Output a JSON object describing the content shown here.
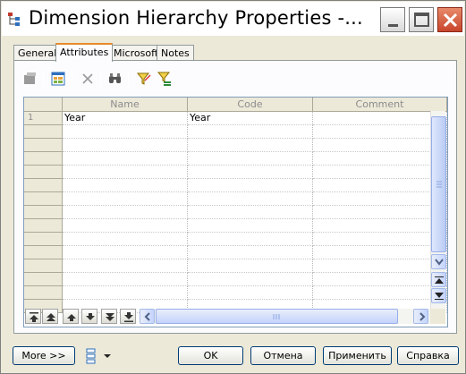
{
  "window": {
    "title": "Dimension Hierarchy Properties -...",
    "controls": [
      "minimize-icon",
      "maximize-icon",
      "close-icon"
    ]
  },
  "tabs": [
    {
      "label": "General",
      "active": false
    },
    {
      "label": "Attributes",
      "active": true
    },
    {
      "label": "Microsoft",
      "active": false
    },
    {
      "label": "Notes",
      "active": false
    }
  ],
  "toolbar": {
    "icons": [
      "properties-icon",
      "add-attributes-icon",
      "delete-icon",
      "find-icon",
      "filter-icon",
      "customize-columns-icon"
    ]
  },
  "grid": {
    "columns": [
      "Name",
      "Code",
      "Comment"
    ],
    "rows": [
      {
        "num": "1",
        "name": "Year",
        "code": "Year",
        "comment": ""
      }
    ],
    "empty_rows": 14
  },
  "navigation": {
    "icons": [
      "move-top-icon",
      "page-up-icon",
      "move-up-icon",
      "move-down-icon",
      "page-down-icon",
      "move-bottom-icon"
    ]
  },
  "buttons": {
    "more": "More >>",
    "ok": "OK",
    "cancel": "Отмена",
    "apply": "Применить",
    "help": "Справка"
  },
  "colors": {
    "accent_tab": "#e68b2c",
    "close_button": "#c8452b",
    "face": "#ece9d8"
  }
}
